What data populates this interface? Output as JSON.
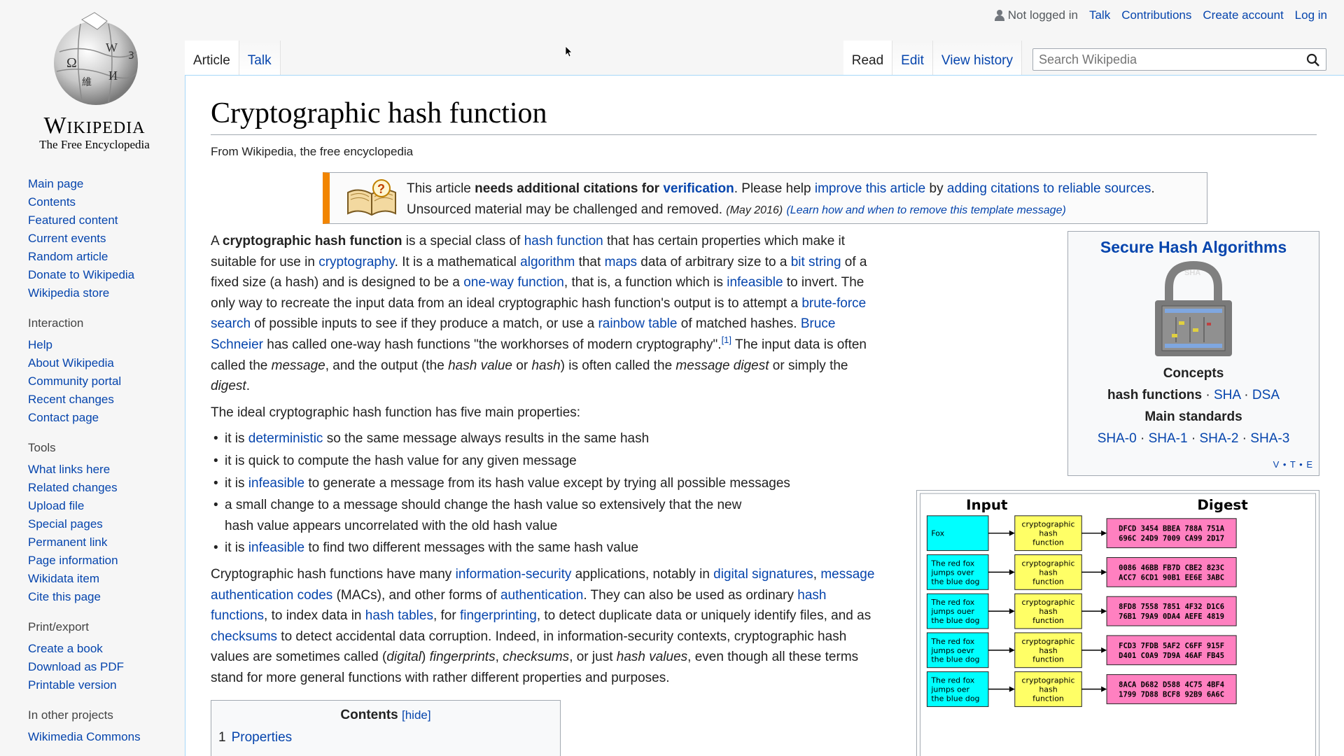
{
  "personal": {
    "not_logged_in": "Not logged in",
    "talk": "Talk",
    "contributions": "Contributions",
    "create_account": "Create account",
    "log_in": "Log in"
  },
  "logo": {
    "wordmark": "Wikipedia",
    "tagline": "The Free Encyclopedia"
  },
  "sidebar": {
    "main_links": [
      "Main page",
      "Contents",
      "Featured content",
      "Current events",
      "Random article",
      "Donate to Wikipedia",
      "Wikipedia store"
    ],
    "interaction_heading": "Interaction",
    "interaction_links": [
      "Help",
      "About Wikipedia",
      "Community portal",
      "Recent changes",
      "Contact page"
    ],
    "tools_heading": "Tools",
    "tools_links": [
      "What links here",
      "Related changes",
      "Upload file",
      "Special pages",
      "Permanent link",
      "Page information",
      "Wikidata item",
      "Cite this page"
    ],
    "print_heading": "Print/export",
    "print_links": [
      "Create a book",
      "Download as PDF",
      "Printable version"
    ],
    "other_heading": "In other projects",
    "other_links": [
      "Wikimedia Commons"
    ]
  },
  "tabs": {
    "article": "Article",
    "talk": "Talk",
    "read": "Read",
    "edit": "Edit",
    "view_history": "View history"
  },
  "search": {
    "placeholder": "Search Wikipedia"
  },
  "article": {
    "title": "Cryptographic hash function",
    "site_sub": "From Wikipedia, the free encyclopedia",
    "ambox": {
      "t1": "This article ",
      "t2": "needs additional citations for ",
      "l1": "verification",
      "t3": ". Please help ",
      "l2": "improve this article",
      "t4": " by ",
      "l3": "adding citations to reliable sources",
      "t5": ". Unsourced material may be challenged and removed. ",
      "date": "(May 2016)",
      "t6": " ",
      "learn": "(Learn how and when to remove this template message)"
    },
    "p1": {
      "a": "A ",
      "b": "cryptographic hash function",
      "c": " is a special class of ",
      "l1": "hash function",
      "d": " that has certain properties which make it suitable for use in ",
      "l2": "cryptography",
      "e": ". It is a mathematical ",
      "l3": "algorithm",
      "f": " that ",
      "l4": "maps",
      "g": " data of arbitrary size to a ",
      "l5": "bit string",
      "h": " of a fixed size (a hash) and is designed to be a ",
      "l6": "one-way function",
      "i": ", that is, a function which is ",
      "l7": "infeasible",
      "j": " to invert. The only way to recreate the input data from an ideal cryptographic hash function's output is to attempt a ",
      "l8": "brute-force search",
      "k": " of possible inputs to see if they produce a match, or use a ",
      "l9": "rainbow table",
      "m": " of matched hashes. ",
      "l10": "Bruce Schneier",
      "n": " has called one-way hash functions \"the workhorses of modern cryptography\".",
      "ref": "[1]",
      "o": " The input data is often called the ",
      "p": "message",
      "q": ", and the output (the ",
      "r": "hash value",
      "s": " or ",
      "t": "hash",
      "u": ") is often called the ",
      "v": "message digest",
      "w": " or simply the ",
      "x": "digest",
      "y": "."
    },
    "p2": "The ideal cryptographic hash function has five main properties:",
    "bullets": {
      "b1a": "it is ",
      "b1l": "deterministic",
      "b1b": " so the same message always results in the same hash",
      "b2": "it is quick to compute the hash value for any given message",
      "b3a": "it is ",
      "b3l": "infeasible",
      "b3b": " to generate a message from its hash value except by trying all possible messages",
      "b4": "a small change to a message should change the hash value so extensively that the new hash value appears uncorrelated with the old hash value",
      "b5a": "it is ",
      "b5l": "infeasible",
      "b5b": " to find two different messages with the same hash value"
    },
    "p3": {
      "a": "Cryptographic hash functions have many ",
      "l1": "information-security",
      "b": " applications, notably in ",
      "l2": "digital signatures",
      "c": ", ",
      "l3": "message authentication codes",
      "d": " (MACs), and other forms of ",
      "l4": "authentication",
      "e": ". They can also be used as ordinary ",
      "l5": "hash functions",
      "f": ", to index data in ",
      "l6": "hash tables",
      "g": ", for ",
      "l7": "fingerprinting",
      "h": ", to detect duplicate data or uniquely identify files, and as ",
      "l8": "checksums",
      "i": " to detect accidental data corruption. Indeed, in information-security contexts, cryptographic hash values are sometimes called (",
      "j": "digital",
      "k": ") ",
      "m": "fingerprints",
      "n": ", ",
      "o": "checksums",
      "p": ", or just ",
      "q": "hash values",
      "r": ", even though all these terms stand for more general functions with rather different properties and purposes."
    }
  },
  "infobox": {
    "title": "Secure Hash Algorithms",
    "lock_label": "SHA",
    "concepts": "Concepts",
    "hash_functions": "hash functions",
    "sep": " · ",
    "sha": "SHA",
    "dsa": "DSA",
    "main_standards": "Main standards",
    "sha0": "SHA-0",
    "sha1": "SHA-1",
    "sha2": "SHA-2",
    "sha3": "SHA-3",
    "vte": "V • T • E"
  },
  "diagram": {
    "input_header": "Input",
    "digest_header": "Digest",
    "function_label": [
      "cryptographic",
      "hash",
      "function"
    ],
    "rows": [
      {
        "input": [
          "Fox"
        ],
        "digest": [
          "DFCD 3454 BBEA 788A 751A",
          "696C 24D9 7009 CA99 2D17"
        ]
      },
      {
        "input": [
          "The red fox",
          "jumps over",
          "the blue dog"
        ],
        "digest": [
          "0086 46BB FB7D CBE2 823C",
          "ACC7 6CD1 90B1 EE6E 3ABC"
        ]
      },
      {
        "input": [
          "The red fox",
          "jumps ouer",
          "the blue dog"
        ],
        "digest": [
          "8FD8 7558 7851 4F32 D1C6",
          "76B1 79A9 0DA4 AEFE 4819"
        ]
      },
      {
        "input": [
          "The red fox",
          "jumps oevr",
          "the blue dog"
        ],
        "digest": [
          "FCD3 7FDB 5AF2 C6FF 915F",
          "D401 C0A9 7D9A 46AF FB45"
        ]
      },
      {
        "input": [
          "The red fox",
          "jumps oer",
          "the blue dog"
        ],
        "digest": [
          "8ACA D682 D588 4C75 4BF4",
          "1799 7D88 BCF8 92B9 6A6C"
        ]
      }
    ],
    "colors": {
      "input": "#00ffff",
      "function": "#ffff66",
      "digest": "#ff80c0"
    }
  },
  "toc": {
    "title": "Contents",
    "hide": "[hide]",
    "item1_num": "1",
    "item1_label": "Properties"
  }
}
